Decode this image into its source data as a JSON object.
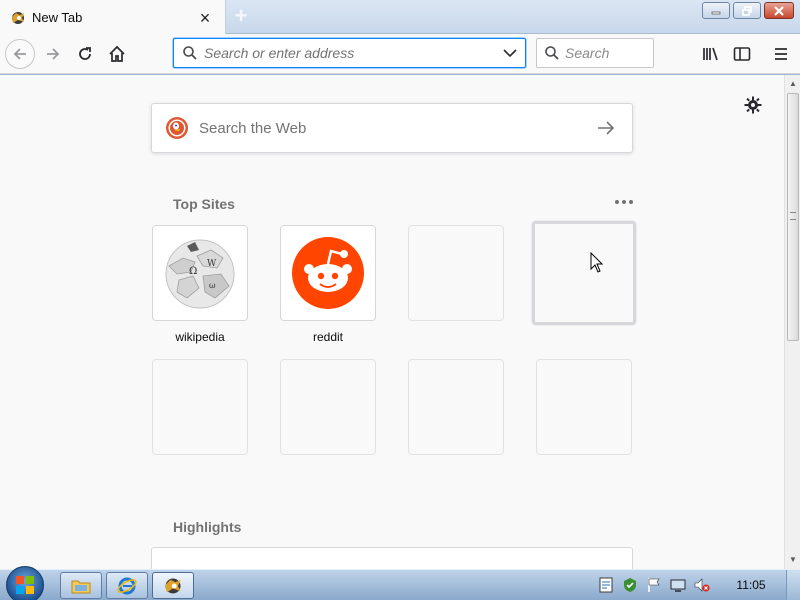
{
  "tab": {
    "title": "New Tab",
    "close_icon": "close-icon"
  },
  "new_tab": {
    "label": "+"
  },
  "window_controls": [
    "minimize",
    "restore",
    "close"
  ],
  "navbar": {
    "url_placeholder": "Search or enter address",
    "search_placeholder": "Search"
  },
  "content": {
    "web_search_placeholder": "Search the Web",
    "top_sites_title": "Top Sites",
    "highlights_title": "Highlights",
    "top_sites": [
      {
        "label": "wikipedia",
        "icon": "wikipedia-globe-icon"
      },
      {
        "label": "reddit",
        "icon": "reddit-alien-icon"
      }
    ]
  },
  "taskbar": {
    "clock": "11:05",
    "tray_icons": [
      "network-icon",
      "security-icon",
      "flag-icon",
      "display-icon",
      "volume-muted-icon"
    ],
    "pinned": [
      "file-explorer-icon",
      "internet-explorer-icon",
      "firefox-icon"
    ]
  },
  "colors": {
    "accent": "#0a84ff",
    "reddit": "#ff4500",
    "duckduckgo": "#de5833"
  }
}
